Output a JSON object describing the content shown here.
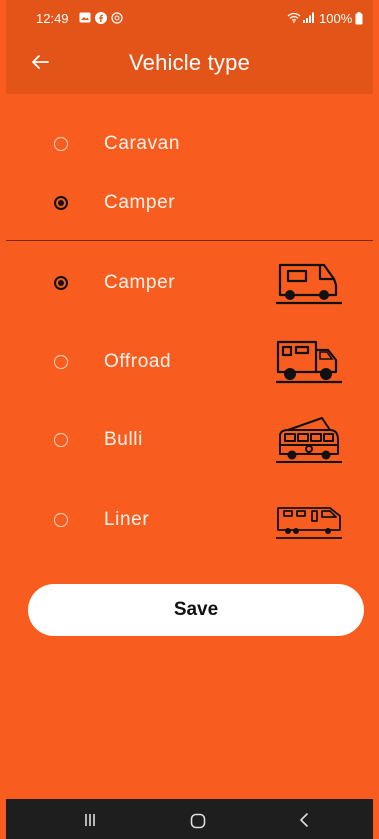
{
  "status_bar": {
    "time": "12:49",
    "battery": "100%",
    "icons": [
      "gallery-icon",
      "facebook-icon",
      "notification-icon",
      "wifi-icon",
      "signal-icon",
      "battery-icon"
    ]
  },
  "app_bar": {
    "title": "Vehicle type",
    "back_icon": "back-arrow-icon"
  },
  "category_options": [
    {
      "label": "Caravan",
      "selected": false
    },
    {
      "label": "Camper",
      "selected": true
    }
  ],
  "vehicle_options": [
    {
      "label": "Camper",
      "selected": true,
      "icon": "camper-van-icon"
    },
    {
      "label": "Offroad",
      "selected": false,
      "icon": "offroad-truck-icon"
    },
    {
      "label": "Bulli",
      "selected": false,
      "icon": "bulli-van-icon"
    },
    {
      "label": "Liner",
      "selected": false,
      "icon": "liner-bus-icon"
    }
  ],
  "save_label": "Save",
  "nav_bar": {
    "icons": [
      "recent-apps-icon",
      "home-icon",
      "back-icon"
    ]
  },
  "colors": {
    "background": "#f85d1f",
    "app_bar": "#e35418",
    "nav_bar": "#1e1e1e",
    "button": "#ffffff"
  }
}
